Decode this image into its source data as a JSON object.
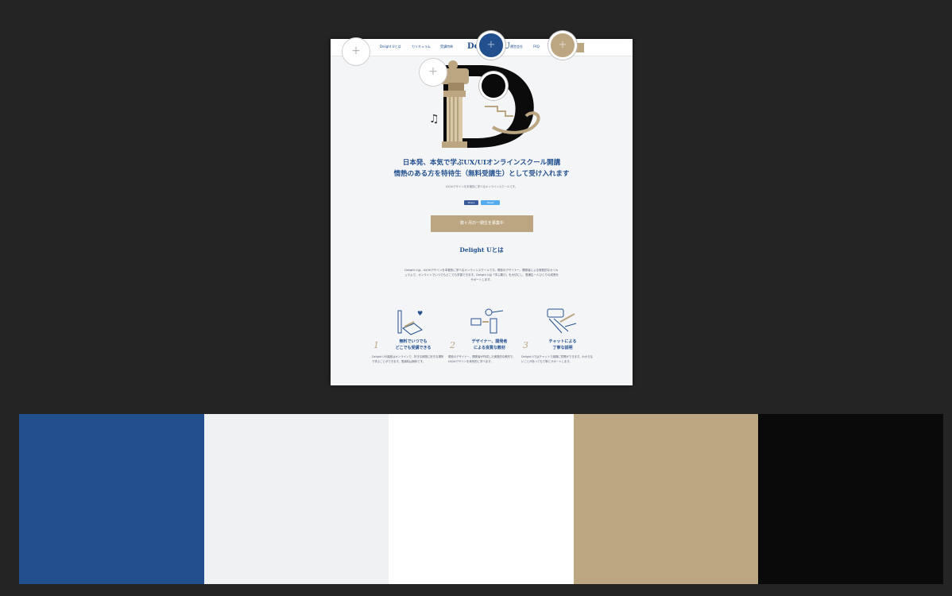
{
  "site": {
    "nav": {
      "links": [
        "Delight Uとは",
        "カリキュラム",
        "受講特典",
        "運営会社",
        "FAQ"
      ],
      "logo": "Delight U"
    },
    "headline_line1": "日本発、本気で学ぶUX/UIオンラインスクール開講",
    "headline_line2": "情熱のある方を特待生（無料受講生）として受け入れます",
    "subtext": "UX/UIデザインを本格的に学べるオンラインスクールです。",
    "share_facebook": "Share",
    "share_twitter": "Tweet",
    "cta": "数ヶ月の一期生を募集中",
    "about_title": "Delight Uとは",
    "about_text": "Delight Uは、UX/UIデザインを本格的に学べるオンラインスクールです。現役のデザイナー、開発者による実践的なカリキュラムで、オンラインでいつでもどこでも学習できます。Delight Uは「学ぶ喜び」を大切にし、受講生一人ひとりの成長をサポートします。",
    "features": [
      {
        "num": "1",
        "title_line1": "無料でいつでも",
        "title_line2": "どこでも受講できる",
        "desc": "Delight Uの講座はオンラインで、好きな時間に好きな場所で学ぶことができます。受講料は無料です。"
      },
      {
        "num": "2",
        "title_line1": "デザイナー、開発者",
        "title_line2": "による良質な教材",
        "desc": "現役のデザイナー、開発者が作成した実践的な教材で、UX/UIデザインを体系的に学べます。"
      },
      {
        "num": "3",
        "title_line1": "チャットによる",
        "title_line2": "丁寧な説明",
        "desc": "Delight Uではチャットで講師に質問ができます。わからないことがあっても丁寧にサポートします。"
      }
    ]
  },
  "markers": {
    "empty_symbol": "+",
    "filled_symbol": "+"
  },
  "colors": {
    "blue": "#22508f",
    "light_gray": "#f0f1f3",
    "white": "#ffffff",
    "tan": "#bca682",
    "black": "#0a0a0a",
    "background": "#242424"
  },
  "palette": [
    {
      "name": "blue",
      "hex": "#22508f"
    },
    {
      "name": "light-gray",
      "hex": "#f0f1f3"
    },
    {
      "name": "white",
      "hex": "#ffffff"
    },
    {
      "name": "tan",
      "hex": "#bca682"
    },
    {
      "name": "black",
      "hex": "#0a0a0a"
    }
  ]
}
